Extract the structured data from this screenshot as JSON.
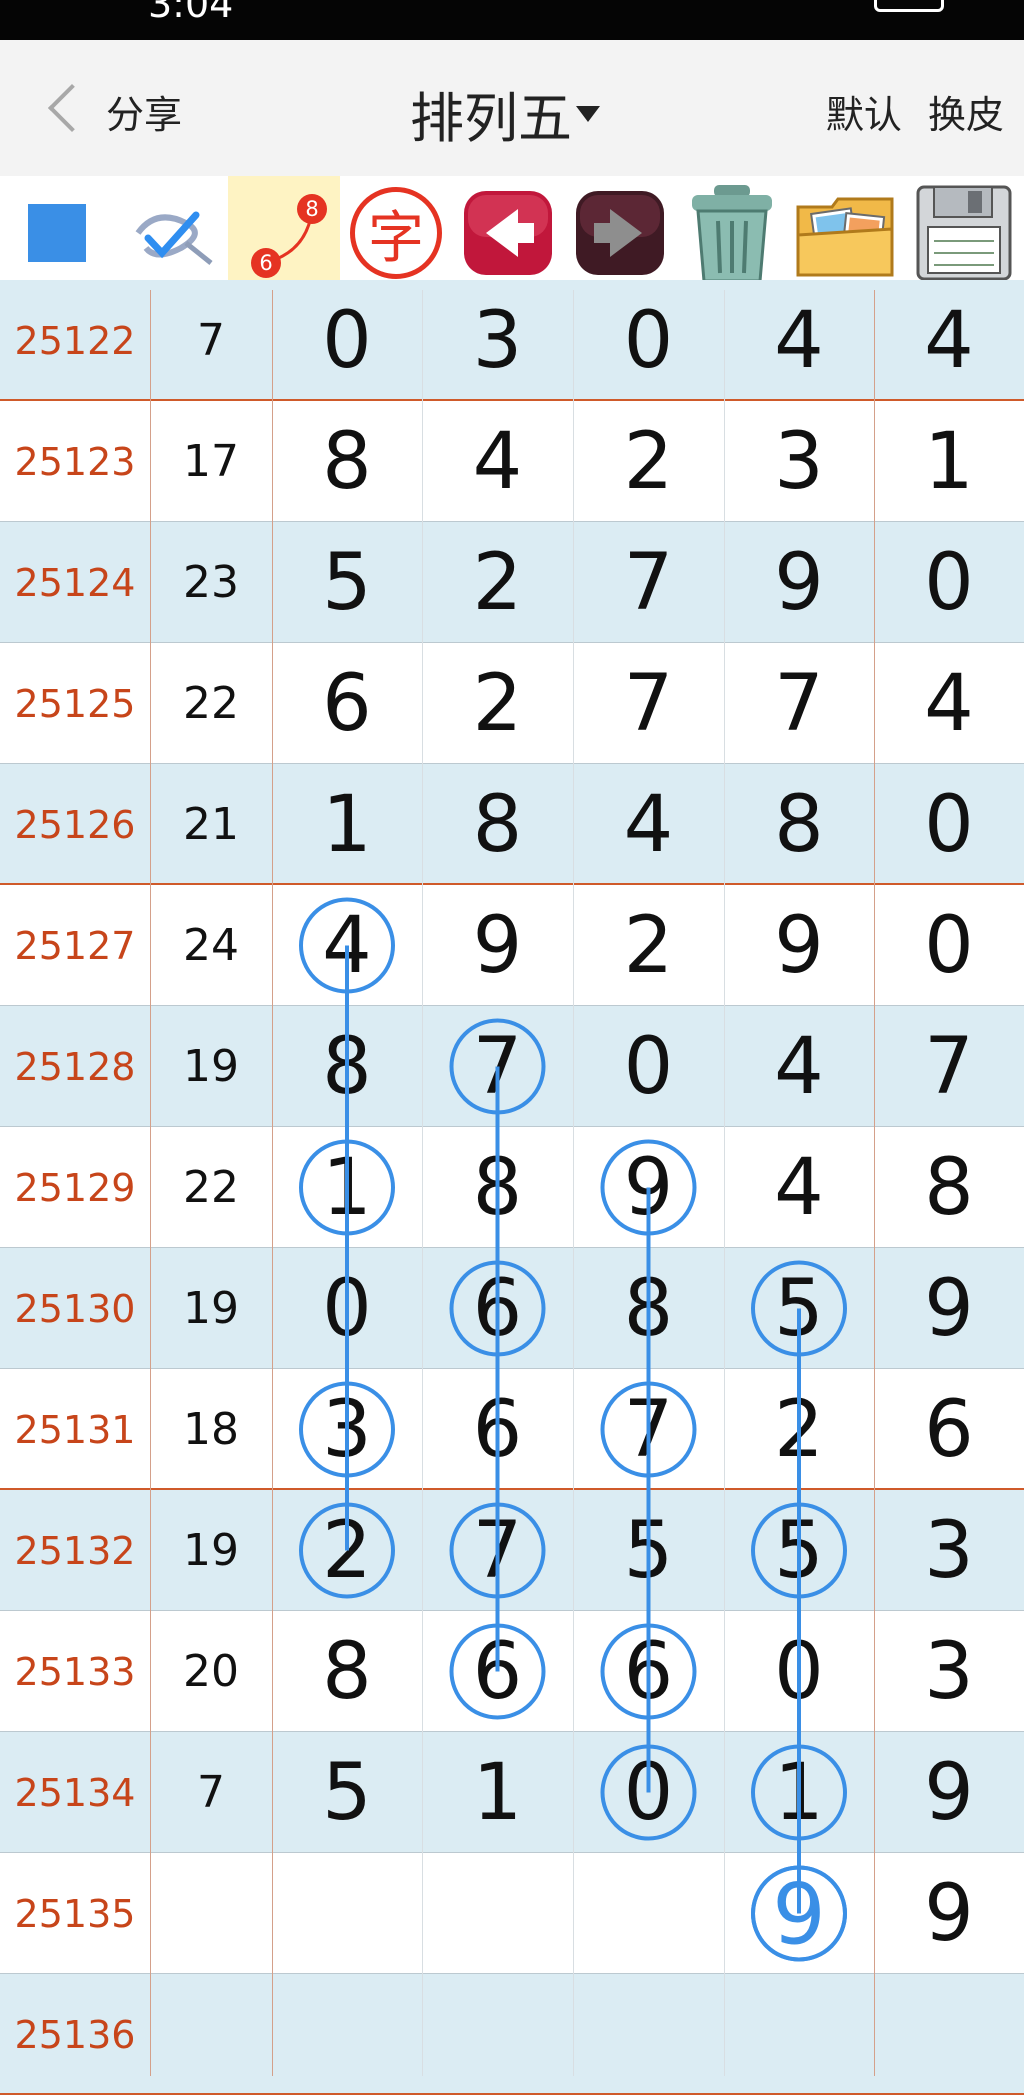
{
  "status_bar": {
    "time": "3:04"
  },
  "header": {
    "share_label": "分享",
    "title": "排列五",
    "actions": [
      "默认",
      "换皮"
    ]
  },
  "toolbar": {
    "tools": [
      {
        "name": "blue-square-tool"
      },
      {
        "name": "check-pen-tool"
      },
      {
        "name": "connect-line-tool",
        "badge_top": "8",
        "badge_bottom": "6"
      },
      {
        "name": "text-tool",
        "label": "字"
      },
      {
        "name": "undo-tool"
      },
      {
        "name": "redo-tool"
      },
      {
        "name": "trash-tool"
      },
      {
        "name": "gallery-tool"
      },
      {
        "name": "save-tool"
      }
    ]
  },
  "table": {
    "rows": [
      {
        "period": "25122",
        "sum": "7",
        "digits": [
          "0",
          "3",
          "0",
          "4",
          "4"
        ]
      },
      {
        "period": "25123",
        "sum": "17",
        "digits": [
          "8",
          "4",
          "2",
          "3",
          "1"
        ]
      },
      {
        "period": "25124",
        "sum": "23",
        "digits": [
          "5",
          "2",
          "7",
          "9",
          "0"
        ]
      },
      {
        "period": "25125",
        "sum": "22",
        "digits": [
          "6",
          "2",
          "7",
          "7",
          "4"
        ]
      },
      {
        "period": "25126",
        "sum": "21",
        "digits": [
          "1",
          "8",
          "4",
          "8",
          "0"
        ]
      },
      {
        "period": "25127",
        "sum": "24",
        "digits": [
          "4",
          "9",
          "2",
          "9",
          "0"
        ]
      },
      {
        "period": "25128",
        "sum": "19",
        "digits": [
          "8",
          "7",
          "0",
          "4",
          "7"
        ]
      },
      {
        "period": "25129",
        "sum": "22",
        "digits": [
          "1",
          "8",
          "9",
          "4",
          "8"
        ]
      },
      {
        "period": "25130",
        "sum": "19",
        "digits": [
          "0",
          "6",
          "8",
          "5",
          "9"
        ]
      },
      {
        "period": "25131",
        "sum": "18",
        "digits": [
          "3",
          "6",
          "7",
          "2",
          "6"
        ]
      },
      {
        "period": "25132",
        "sum": "19",
        "digits": [
          "2",
          "7",
          "5",
          "5",
          "3"
        ]
      },
      {
        "period": "25133",
        "sum": "20",
        "digits": [
          "8",
          "6",
          "6",
          "0",
          "3"
        ]
      },
      {
        "period": "25134",
        "sum": "7",
        "digits": [
          "5",
          "1",
          "0",
          "1",
          "9"
        ]
      },
      {
        "period": "25135",
        "sum": "",
        "digits": [
          "",
          "",
          "",
          "",
          "9"
        ]
      },
      {
        "period": "25136",
        "sum": "",
        "digits": [
          "",
          "",
          "",
          "",
          ""
        ]
      }
    ],
    "marks": {
      "0": [
        5,
        7,
        9,
        10
      ],
      "1": [
        6,
        8,
        10,
        11
      ],
      "2": [
        7,
        9,
        11,
        12
      ],
      "3": [
        8,
        10,
        12,
        13
      ]
    },
    "predicted": {
      "row": 13,
      "col": 3,
      "value": "9"
    },
    "colors": {
      "mark": "#3a8fe6",
      "period": "#c7451a",
      "row_alt": "#dbecf3"
    }
  }
}
